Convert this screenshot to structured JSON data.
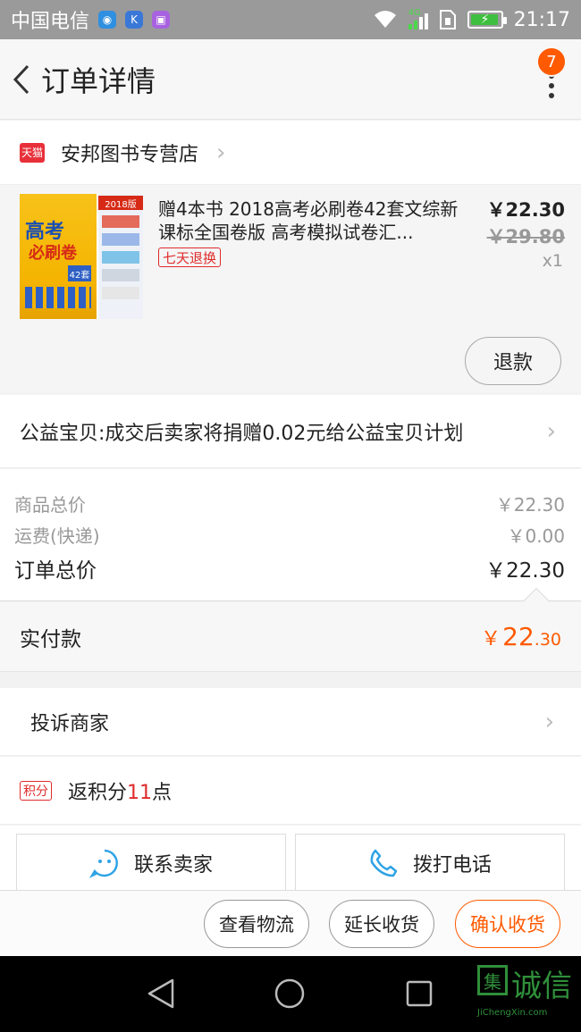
{
  "status_bar": {
    "carrier": "中国电信",
    "time": "21:17",
    "network_label": "4G"
  },
  "header": {
    "title": "订单详情",
    "badge_count": "7"
  },
  "shop": {
    "tag": "天猫",
    "name": "安邦图书专营店"
  },
  "product": {
    "title": "赠4本书 2018高考必刷卷42套文综新课标全国卷版 高考模拟试卷汇...",
    "return_tag": "七天退换",
    "price": "￥22.30",
    "original_price": "￥29.80",
    "quantity": "x1",
    "refund_label": "退款",
    "cover": {
      "title_line1": "高考",
      "title_line2": "必刷卷",
      "sets": "42套",
      "year": "2018版"
    }
  },
  "charity": {
    "text": "公益宝贝:成交后卖家将捐赠0.02元给公益宝贝计划"
  },
  "totals": {
    "goods_label": "商品总价",
    "goods_value": "￥22.30",
    "shipping_label": "运费(快递)",
    "shipping_value": "￥0.00",
    "order_label": "订单总价",
    "order_value": "￥22.30"
  },
  "paid": {
    "label": "实付款",
    "currency": "￥",
    "integer": "22",
    "decimal": ".30"
  },
  "complain": {
    "label": "投诉商家"
  },
  "points": {
    "tag": "积分",
    "prefix": "返积分",
    "value": "11",
    "suffix": "点"
  },
  "contact": {
    "seller_label": "联系卖家",
    "phone_label": "拨打电话"
  },
  "actions": {
    "logistics": "查看物流",
    "extend": "延长收货",
    "confirm": "确认收货"
  },
  "watermark": {
    "char": "集",
    "brand": "诚信",
    "domain": "JiChengXin.com"
  },
  "colors": {
    "accent": "#ff5a00",
    "tag_red": "#e02b2b",
    "tmall_red": "#e8303a"
  }
}
